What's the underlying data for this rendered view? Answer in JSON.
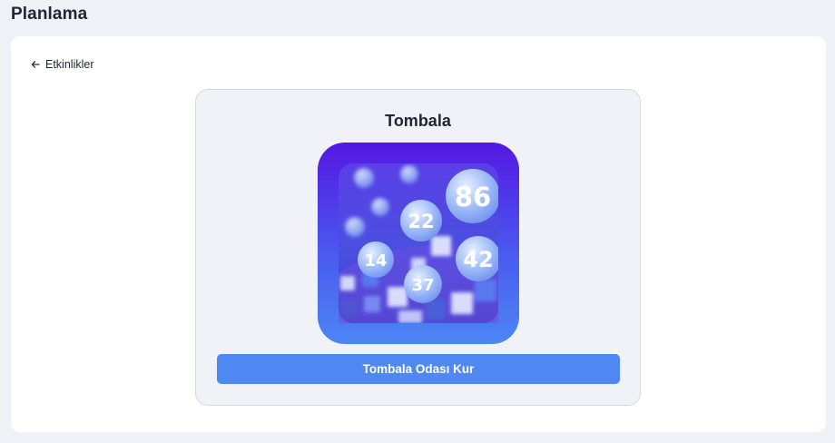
{
  "header": {
    "title": "Planlama"
  },
  "nav": {
    "back_label": "Etkinlikler",
    "back_icon": "arrow-left-icon"
  },
  "game": {
    "title": "Tombala",
    "image_icon": "bingo-balls-illustration",
    "balls": [
      "86",
      "22",
      "14",
      "42",
      "37"
    ],
    "cta_label": "Tombala Odası Kur"
  },
  "colors": {
    "page_bg": "#f0f1f6",
    "card_bg": "#ffffff",
    "panel_bg": "#f1f2f7",
    "accent": "#4f88f3",
    "thumb_top": "#5517e3",
    "thumb_bottom": "#4d86f4"
  }
}
